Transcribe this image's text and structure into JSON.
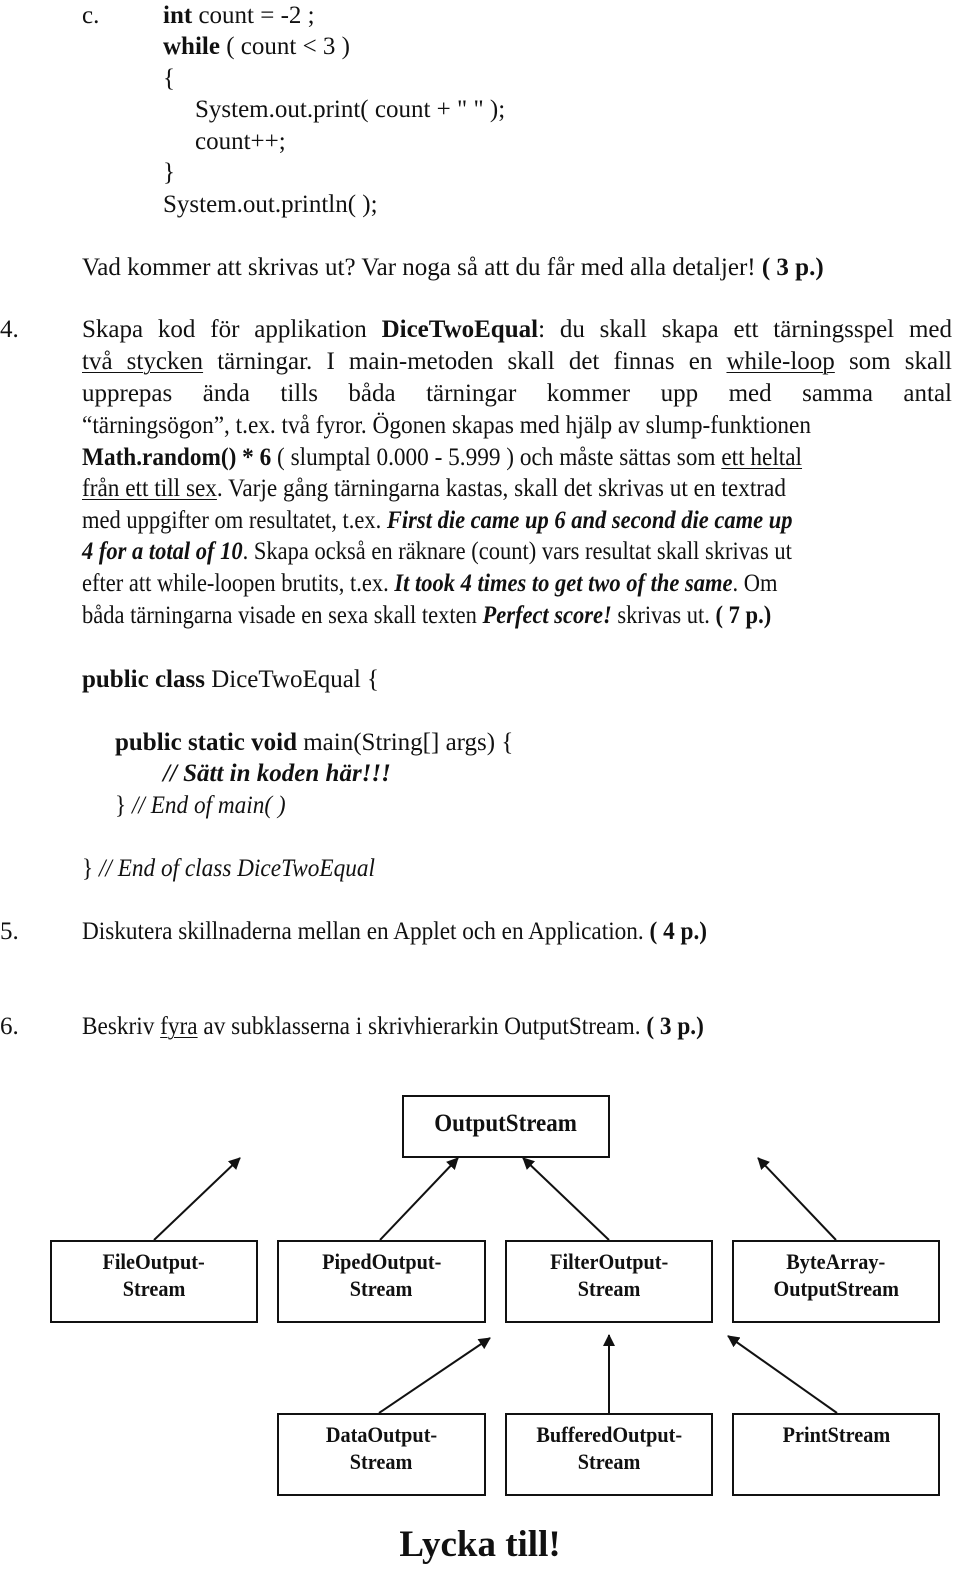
{
  "question_c": {
    "label": "c.",
    "code_lines": [
      {
        "kw": "int",
        "rest": " count = -2 ;"
      },
      {
        "kw": "while",
        "rest": " ( count < 3 )"
      },
      {
        "kw": "",
        "rest": "{"
      },
      {
        "kw": "",
        "rest": "System.out.print( count + \" \" );"
      },
      {
        "kw": "",
        "rest": "count++;"
      },
      {
        "kw": "",
        "rest": "}"
      },
      {
        "kw": "",
        "rest": "System.out.println( );"
      }
    ],
    "prompt": "Vad kommer att skrivas ut? Var noga så att du får med alla detaljer! ",
    "points": "( 3 p.)"
  },
  "question_4": {
    "number": "4.",
    "l1_a": "Skapa kod för applikation ",
    "l1_b": "DiceTwoEqual",
    "l1_c": ": du skall skapa ett tärningsspel med",
    "l2_a": "två stycken",
    "l2_b": " tärningar. I main-metoden skall det finnas en ",
    "l2_c": "while-loop",
    "l2_d": " som skall",
    "l3": "upprepas ända tills båda tärningar kommer upp med samma antal",
    "l4": "“tärningsögon”, t.ex. två fyror. Ögonen skapas med hjälp av slump-funktionen",
    "l5_a": "Math.random() * 6",
    "l5_b": " ( slumptal 0.000 - 5.999 ) och måste sättas som ",
    "l5_c": "ett heltal",
    "l6_a": "från ett till sex",
    "l6_b": ". Varje gång tärningarna kastas, skall det skrivas ut en textrad",
    "l7_a": "med uppgifter om resultatet, t.ex. ",
    "l7_b": "First die came up 6 and second die came up",
    "l8_a": "4 for a total of 10",
    "l8_b": ". Skapa också en räknare (count) vars resultat skall skrivas ut",
    "l9_a": "efter att while-loopen brutits, t.ex. ",
    "l9_b": "It took 4 times to get two of the same",
    "l9_c": ". Om",
    "l10_a": "båda tärningarna visade en sexa skall texten ",
    "l10_b": "Perfect score!",
    "l10_c": " skrivas ut. ",
    "points": "( 7 p.)"
  },
  "code_template": {
    "class_kw": "public class",
    "class_rest": " DiceTwoEqual {",
    "main_kw": "public static void",
    "main_rest": " main(String[] args) {",
    "insert_comment": "//  Sätt in koden här!!!",
    "end_main_brace": "} ",
    "end_main_comment": "// End of main( )",
    "end_class_brace": "} ",
    "end_class_comment": "// End of class DiceTwoEqual"
  },
  "question_5": {
    "number": "5.",
    "text": "Diskutera skillnaderna mellan en Applet och en Application. ",
    "points": "( 4 p.)"
  },
  "question_6": {
    "number": "6.",
    "text_a": "Beskriv ",
    "text_b": "fyra",
    "text_c": " av subklasserna i skrivhierarkin OutputStream. ",
    "points": "( 3 p.)"
  },
  "diagram": {
    "root": "OutputStream",
    "level1": [
      {
        "line1": "FileOutput-",
        "line2": "Stream"
      },
      {
        "line1": "PipedOutput-",
        "line2": "Stream"
      },
      {
        "line1": "FilterOutput-",
        "line2": "Stream"
      },
      {
        "line1": "ByteArray-",
        "line2": "OutputStream"
      }
    ],
    "level2": [
      {
        "line1": "DataOutput-",
        "line2": "Stream"
      },
      {
        "line1": "BufferedOutput-",
        "line2": "Stream"
      },
      {
        "line1": "PrintStream",
        "line2": ""
      }
    ]
  },
  "footer": "Lycka till!"
}
